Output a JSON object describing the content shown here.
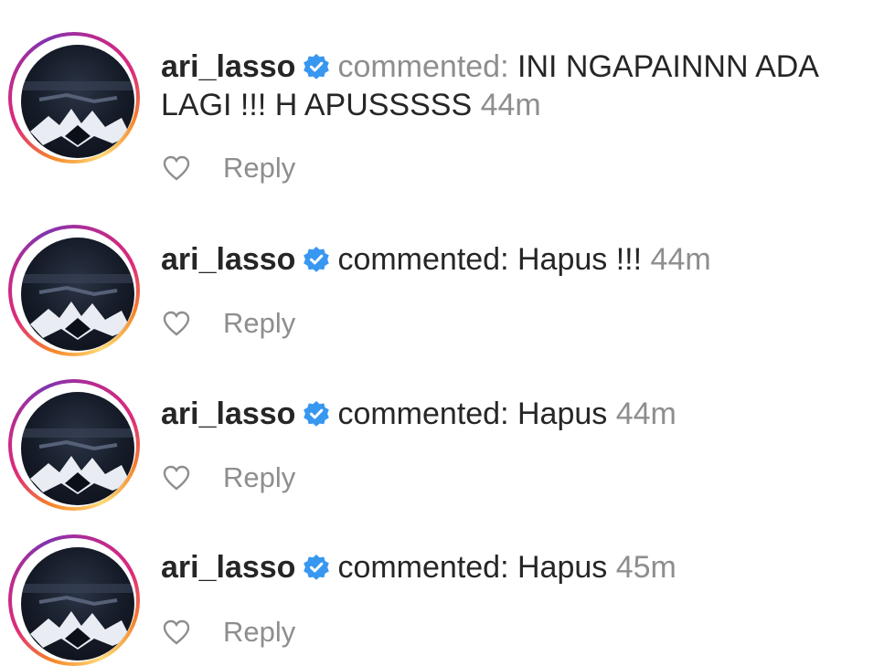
{
  "comments": [
    {
      "username": "ari_lasso",
      "verified": true,
      "verb": "commented:",
      "text": "INI NGAPAINNN ADA LAGI !!! H APUSSSSS",
      "time": "44m",
      "reply_label": "Reply",
      "icon": "heart-outline-icon"
    },
    {
      "username": "ari_lasso",
      "verified": true,
      "verb": "commented:",
      "text": "Hapus !!!",
      "time": "44m",
      "reply_label": "Reply",
      "icon": "heart-outline-icon"
    },
    {
      "username": "ari_lasso",
      "verified": true,
      "verb": "commented:",
      "text": "Hapus",
      "time": "44m",
      "reply_label": "Reply",
      "icon": "heart-outline-icon"
    },
    {
      "username": "ari_lasso",
      "verified": true,
      "verb": "commented:",
      "text": "Hapus",
      "time": "45m",
      "reply_label": "Reply",
      "icon": "heart-outline-icon"
    }
  ],
  "colors": {
    "text": "#262626",
    "muted": "#8e8e8e",
    "verified_badge": "#3897f0",
    "story_ring_start": "#f58529",
    "story_ring_end": "#8134af"
  }
}
